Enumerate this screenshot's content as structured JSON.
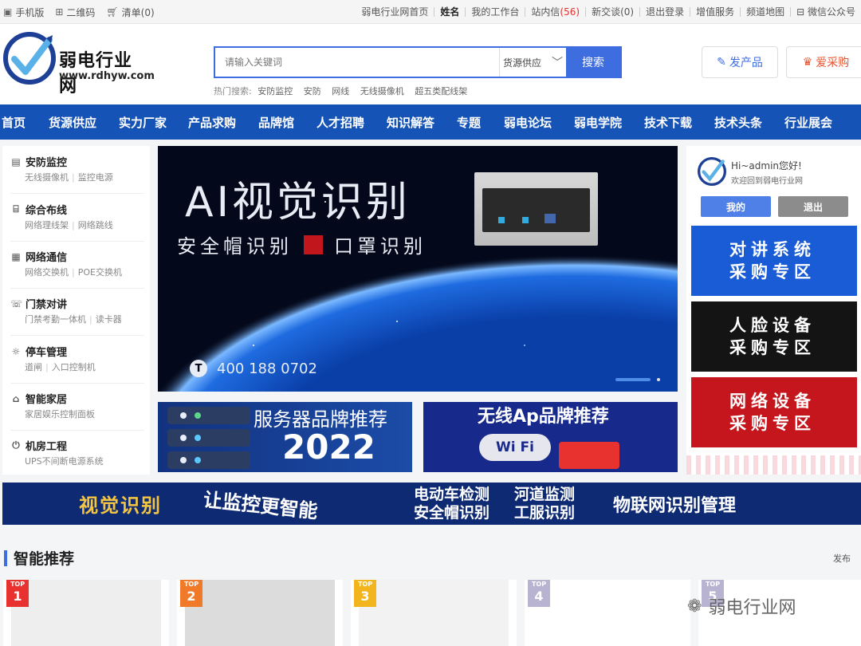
{
  "topbar": {
    "mobile": "手机版",
    "qrcode": "二维码",
    "cart": "清单(0)",
    "right_items": [
      "弱电行业网首页",
      "姓名",
      "我的工作台"
    ],
    "inbox_label": "站内信",
    "inbox_count": "(56)",
    "right_items2": [
      "新交谈(0)",
      "退出登录",
      "增值服务",
      "频道地图"
    ],
    "wechat": "微信公众号"
  },
  "logo": {
    "name": "弱电行业网",
    "domain": "www.rdhyw.com"
  },
  "search": {
    "placeholder": "请输入关键词",
    "scope": "货源供应",
    "button": "搜索",
    "hot_label": "热门搜索:",
    "hot": [
      "安防监控",
      "安防",
      "网线",
      "无线摄像机",
      "超五类配线架"
    ]
  },
  "header_buttons": {
    "publish": "发产品",
    "purchase": "爱采购"
  },
  "nav": [
    "首页",
    "货源供应",
    "实力厂家",
    "产品求购",
    "品牌馆",
    "人才招聘",
    "知识解答",
    "专题",
    "弱电论坛",
    "弱电学院",
    "技术下载",
    "技术头条",
    "行业展会"
  ],
  "categories": [
    {
      "title": "安防监控",
      "subs": [
        "无线摄像机",
        "监控电源"
      ],
      "icon": "cabinet-icon"
    },
    {
      "title": "综合布线",
      "subs": [
        "网络理线架",
        "网络跳线"
      ],
      "icon": "cable-icon"
    },
    {
      "title": "网络通信",
      "subs": [
        "网络交换机",
        "POE交换机"
      ],
      "icon": "switch-icon"
    },
    {
      "title": "门禁对讲",
      "subs": [
        "门禁考勤一体机",
        "读卡器"
      ],
      "icon": "intercom-icon"
    },
    {
      "title": "停车管理",
      "subs": [
        "道闸",
        "入口控制机"
      ],
      "icon": "bulb-icon"
    },
    {
      "title": "智能家居",
      "subs": [
        "家居娱乐控制面板"
      ],
      "icon": "home-icon"
    },
    {
      "title": "机房工程",
      "subs": [
        "UPS不间断电源系统"
      ],
      "icon": "power-icon"
    }
  ],
  "banner": {
    "title": "AI视觉识别",
    "line2a": "安全帽识别",
    "line2b": "口罩识别",
    "phone": "400 188 0702"
  },
  "sub_banners": [
    {
      "title": "服务器品牌推荐",
      "year": "2022"
    },
    {
      "title": "无线Ap品牌推荐",
      "wifi": "Wi Fi"
    }
  ],
  "user": {
    "greeting": "Hi~admin您好!",
    "welcome": "欢迎回到弱电行业网",
    "mine": "我的",
    "logout": "退出"
  },
  "zones": [
    {
      "line1": "对讲系统",
      "line2": "采购专区",
      "color": "#1a5cd6"
    },
    {
      "line1": "人脸设备",
      "line2": "采购专区",
      "color": "#141414"
    },
    {
      "line1": "网络设备",
      "line2": "采购专区",
      "color": "#c4161c"
    }
  ],
  "strip": {
    "a": "视觉识别",
    "b": "让监控更智能",
    "c1": "电动车检测",
    "c2": "安全帽识别",
    "d1": "河道监测",
    "d2": "工服识别",
    "e": "物联网识别管理"
  },
  "section": {
    "title": "智能推荐",
    "publish": "发布"
  },
  "products": [
    {
      "rank": "1",
      "top": "TOP",
      "color": "#e8322f"
    },
    {
      "rank": "2",
      "top": "TOP",
      "color": "#f07a2a"
    },
    {
      "rank": "3",
      "top": "TOP",
      "color": "#f2b51d"
    },
    {
      "rank": "4",
      "top": "TOP",
      "color": "#b7b3d0"
    },
    {
      "rank": "5",
      "top": "TOP",
      "color": "#b7b3d0"
    }
  ],
  "watermark": "弱电行业网"
}
